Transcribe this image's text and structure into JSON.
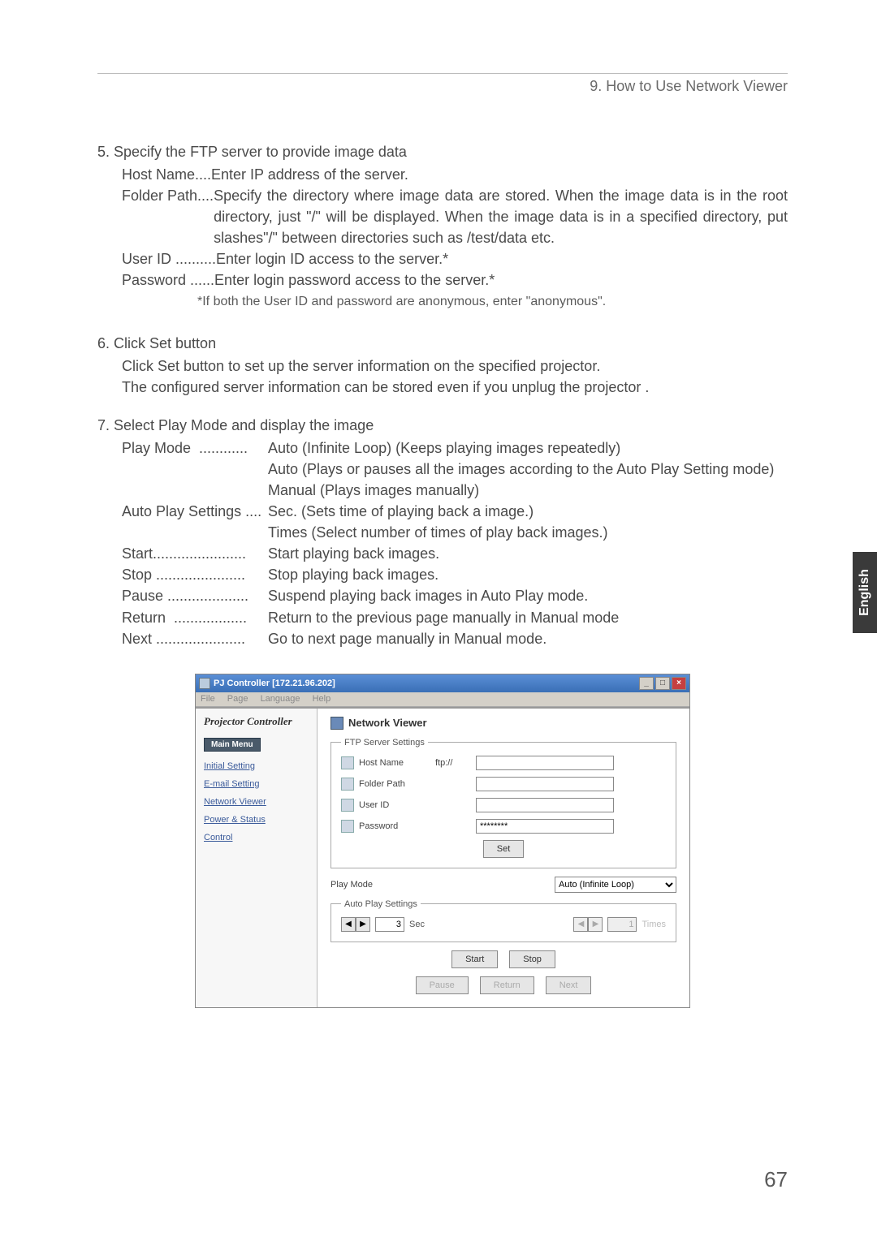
{
  "header": {
    "section": "9. How to Use Network Viewer"
  },
  "step5": {
    "title": "5. Specify the FTP server to provide image data",
    "host_label": "Host Name....",
    "host_desc": " Enter IP address of the server.",
    "folder_label": "Folder Path....",
    "folder_desc": " Specify the directory where image data are stored.  When the image data is in the root directory, just \"/\" will be displayed.  When the image data is in a specified directory, put slashes\"/\" between directories such as /test/data etc.",
    "user_label": "User ID ..........",
    "user_desc": "Enter login ID access to the server.*",
    "pass_label": "Password ......",
    "pass_desc": "Enter login password access to the server.*",
    "note": "*If both  the User ID and password are anonymous, enter \"anonymous\"."
  },
  "step6": {
    "title": "6. Click Set button",
    "line1": "Click Set button to set up the server information on the specified projector.",
    "line2": "The configured server information can be stored even if you unplug the projector ."
  },
  "step7": {
    "title": "7. Select Play Mode and display the image",
    "rows": [
      {
        "lbl": "Play Mode  ............",
        "val": "Auto (Infinite Loop) (Keeps playing images repeatedly)"
      },
      {
        "lbl": "",
        "val": "Auto (Plays or pauses all the images according to the Auto Play Setting mode)"
      },
      {
        "lbl": "",
        "val": "Manual (Plays images manually)"
      },
      {
        "lbl": "Auto Play Settings ....",
        "val": "Sec. (Sets time of playing back a image.)"
      },
      {
        "lbl": "",
        "val": "Times (Select number of times of play back images.)"
      },
      {
        "lbl": "Start.......................",
        "val": "Start playing back images."
      },
      {
        "lbl": "Stop ......................",
        "val": "Stop playing back images."
      },
      {
        "lbl": "Pause ....................",
        "val": "Suspend playing back images in Auto Play mode."
      },
      {
        "lbl": "Return  ..................",
        "val": "Return to the previous page manually in Manual mode"
      },
      {
        "lbl": "Next ......................",
        "val": "Go to next page manually in Manual mode."
      }
    ]
  },
  "side_tab": "English",
  "page_number": "67",
  "app": {
    "title": "PJ Controller [172.21.96.202]",
    "menu": {
      "file": "File",
      "page": "Page",
      "language": "Language",
      "help": "Help"
    },
    "sidebar": {
      "title": "Projector Controller",
      "main_menu": "Main Menu",
      "links": {
        "initial": "Initial Setting",
        "email": "E-mail Setting",
        "network_viewer": "Network Viewer",
        "power_status": "Power & Status",
        "control": "Control"
      }
    },
    "content": {
      "title": "Network Viewer",
      "ftp_legend": "FTP Server Settings",
      "host_label": "Host Name",
      "host_prefix": "ftp://",
      "host_value": "",
      "folder_label": "Folder Path",
      "folder_value": "",
      "user_label": "User ID",
      "user_value": "",
      "password_label": "Password",
      "password_value": "********",
      "set_btn": "Set",
      "play_mode_label": "Play Mode",
      "play_mode_selected": "Auto (Infinite Loop)",
      "aps_legend": "Auto Play Settings",
      "sec_value": "3",
      "sec_unit": "Sec",
      "times_value": "1",
      "times_unit": "Times",
      "buttons": {
        "start": "Start",
        "stop": "Stop",
        "pause": "Pause",
        "return": "Return",
        "next": "Next"
      }
    }
  }
}
